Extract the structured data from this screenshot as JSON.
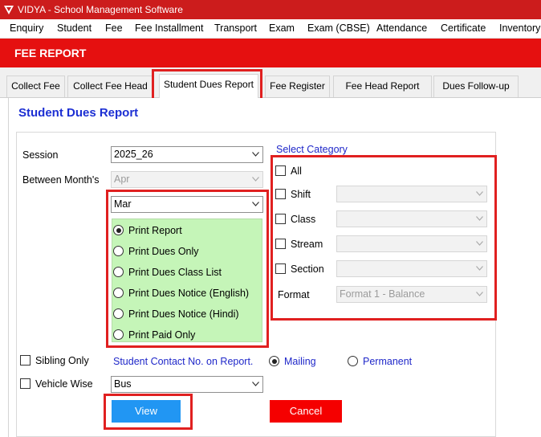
{
  "window": {
    "title": "VIDYA - School Management Software"
  },
  "menu": [
    "Enquiry",
    "Student",
    "Fee",
    "Fee Installment",
    "Transport",
    "Exam",
    "Exam (CBSE)",
    "Attendance",
    "Certificate",
    "Inventory"
  ],
  "banner": {
    "title": "FEE REPORT"
  },
  "tabs": [
    "Collect Fee",
    "Collect Fee Head",
    "Student Dues Report",
    "Fee Register",
    "Fee Head Report",
    "Dues Follow-up"
  ],
  "active_tab": "Student Dues Report",
  "form": {
    "section_title": "Student Dues Report",
    "session_label": "Session",
    "session_value": "2025_26",
    "between_label": "Between Month's",
    "from_month": "Apr",
    "to_month": "Mar",
    "print_options": [
      {
        "label": "Print Report",
        "selected": true
      },
      {
        "label": "Print Dues Only",
        "selected": false
      },
      {
        "label": "Print Dues Class List",
        "selected": false
      },
      {
        "label": "Print Dues Notice (English)",
        "selected": false
      },
      {
        "label": "Print Dues Notice (Hindi)",
        "selected": false
      },
      {
        "label": "Print Paid Only",
        "selected": false
      }
    ],
    "category": {
      "title": "Select Category",
      "all_label": "All",
      "shift_label": "Shift",
      "class_label": "Class",
      "stream_label": "Stream",
      "section_label": "Section",
      "format_label": "Format",
      "format_value": "Format 1 - Balance"
    },
    "sibling_label": "Sibling Only",
    "vehicle_label": "Vehicle Wise",
    "vehicle_value": "Bus",
    "contact_label": "Student Contact No. on Report.",
    "mailing_label": "Mailing",
    "permanent_label": "Permanent",
    "view_label": "View",
    "cancel_label": "Cancel"
  },
  "colors": {
    "title_bar": "#cc1c1c",
    "banner": "#e51010",
    "view_button": "#2196f3",
    "cancel_button": "#f50000",
    "options_bg": "#c5f5b8",
    "highlight": "#e02020"
  }
}
